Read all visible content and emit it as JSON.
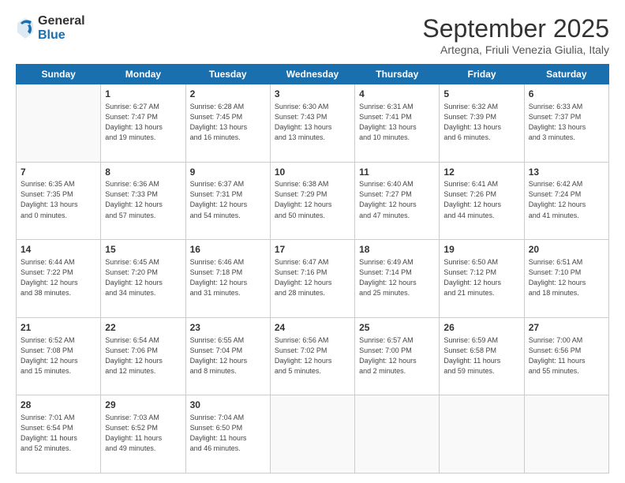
{
  "logo": {
    "general": "General",
    "blue": "Blue"
  },
  "header": {
    "month": "September 2025",
    "location": "Artegna, Friuli Venezia Giulia, Italy"
  },
  "weekdays": [
    "Sunday",
    "Monday",
    "Tuesday",
    "Wednesday",
    "Thursday",
    "Friday",
    "Saturday"
  ],
  "weeks": [
    [
      {
        "day": "",
        "info": ""
      },
      {
        "day": "1",
        "info": "Sunrise: 6:27 AM\nSunset: 7:47 PM\nDaylight: 13 hours\nand 19 minutes."
      },
      {
        "day": "2",
        "info": "Sunrise: 6:28 AM\nSunset: 7:45 PM\nDaylight: 13 hours\nand 16 minutes."
      },
      {
        "day": "3",
        "info": "Sunrise: 6:30 AM\nSunset: 7:43 PM\nDaylight: 13 hours\nand 13 minutes."
      },
      {
        "day": "4",
        "info": "Sunrise: 6:31 AM\nSunset: 7:41 PM\nDaylight: 13 hours\nand 10 minutes."
      },
      {
        "day": "5",
        "info": "Sunrise: 6:32 AM\nSunset: 7:39 PM\nDaylight: 13 hours\nand 6 minutes."
      },
      {
        "day": "6",
        "info": "Sunrise: 6:33 AM\nSunset: 7:37 PM\nDaylight: 13 hours\nand 3 minutes."
      }
    ],
    [
      {
        "day": "7",
        "info": "Sunrise: 6:35 AM\nSunset: 7:35 PM\nDaylight: 13 hours\nand 0 minutes."
      },
      {
        "day": "8",
        "info": "Sunrise: 6:36 AM\nSunset: 7:33 PM\nDaylight: 12 hours\nand 57 minutes."
      },
      {
        "day": "9",
        "info": "Sunrise: 6:37 AM\nSunset: 7:31 PM\nDaylight: 12 hours\nand 54 minutes."
      },
      {
        "day": "10",
        "info": "Sunrise: 6:38 AM\nSunset: 7:29 PM\nDaylight: 12 hours\nand 50 minutes."
      },
      {
        "day": "11",
        "info": "Sunrise: 6:40 AM\nSunset: 7:27 PM\nDaylight: 12 hours\nand 47 minutes."
      },
      {
        "day": "12",
        "info": "Sunrise: 6:41 AM\nSunset: 7:26 PM\nDaylight: 12 hours\nand 44 minutes."
      },
      {
        "day": "13",
        "info": "Sunrise: 6:42 AM\nSunset: 7:24 PM\nDaylight: 12 hours\nand 41 minutes."
      }
    ],
    [
      {
        "day": "14",
        "info": "Sunrise: 6:44 AM\nSunset: 7:22 PM\nDaylight: 12 hours\nand 38 minutes."
      },
      {
        "day": "15",
        "info": "Sunrise: 6:45 AM\nSunset: 7:20 PM\nDaylight: 12 hours\nand 34 minutes."
      },
      {
        "day": "16",
        "info": "Sunrise: 6:46 AM\nSunset: 7:18 PM\nDaylight: 12 hours\nand 31 minutes."
      },
      {
        "day": "17",
        "info": "Sunrise: 6:47 AM\nSunset: 7:16 PM\nDaylight: 12 hours\nand 28 minutes."
      },
      {
        "day": "18",
        "info": "Sunrise: 6:49 AM\nSunset: 7:14 PM\nDaylight: 12 hours\nand 25 minutes."
      },
      {
        "day": "19",
        "info": "Sunrise: 6:50 AM\nSunset: 7:12 PM\nDaylight: 12 hours\nand 21 minutes."
      },
      {
        "day": "20",
        "info": "Sunrise: 6:51 AM\nSunset: 7:10 PM\nDaylight: 12 hours\nand 18 minutes."
      }
    ],
    [
      {
        "day": "21",
        "info": "Sunrise: 6:52 AM\nSunset: 7:08 PM\nDaylight: 12 hours\nand 15 minutes."
      },
      {
        "day": "22",
        "info": "Sunrise: 6:54 AM\nSunset: 7:06 PM\nDaylight: 12 hours\nand 12 minutes."
      },
      {
        "day": "23",
        "info": "Sunrise: 6:55 AM\nSunset: 7:04 PM\nDaylight: 12 hours\nand 8 minutes."
      },
      {
        "day": "24",
        "info": "Sunrise: 6:56 AM\nSunset: 7:02 PM\nDaylight: 12 hours\nand 5 minutes."
      },
      {
        "day": "25",
        "info": "Sunrise: 6:57 AM\nSunset: 7:00 PM\nDaylight: 12 hours\nand 2 minutes."
      },
      {
        "day": "26",
        "info": "Sunrise: 6:59 AM\nSunset: 6:58 PM\nDaylight: 11 hours\nand 59 minutes."
      },
      {
        "day": "27",
        "info": "Sunrise: 7:00 AM\nSunset: 6:56 PM\nDaylight: 11 hours\nand 55 minutes."
      }
    ],
    [
      {
        "day": "28",
        "info": "Sunrise: 7:01 AM\nSunset: 6:54 PM\nDaylight: 11 hours\nand 52 minutes."
      },
      {
        "day": "29",
        "info": "Sunrise: 7:03 AM\nSunset: 6:52 PM\nDaylight: 11 hours\nand 49 minutes."
      },
      {
        "day": "30",
        "info": "Sunrise: 7:04 AM\nSunset: 6:50 PM\nDaylight: 11 hours\nand 46 minutes."
      },
      {
        "day": "",
        "info": ""
      },
      {
        "day": "",
        "info": ""
      },
      {
        "day": "",
        "info": ""
      },
      {
        "day": "",
        "info": ""
      }
    ]
  ]
}
